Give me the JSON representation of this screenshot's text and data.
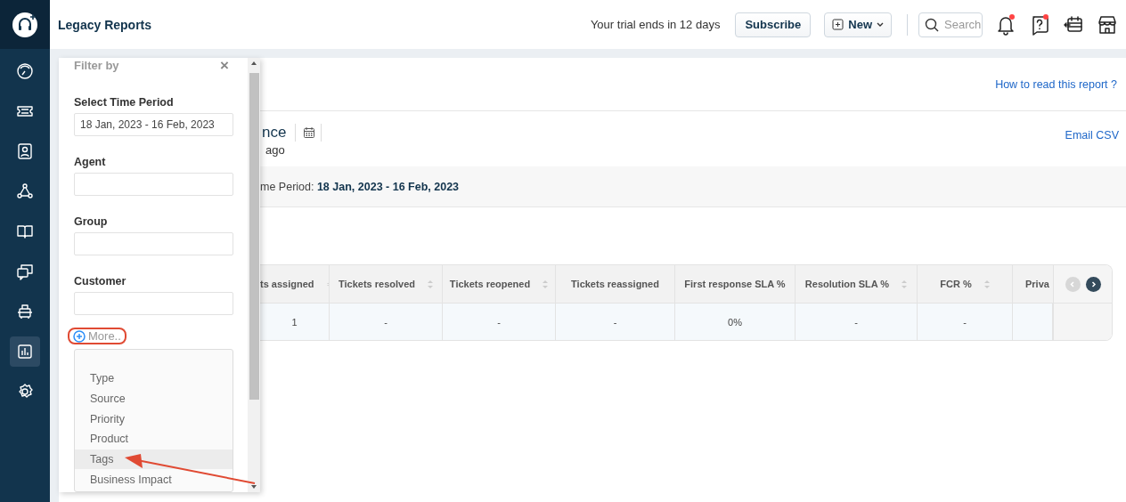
{
  "app": {
    "title": "Legacy Reports"
  },
  "sidebar": {
    "items": [
      {
        "kind": "dashboard",
        "selected": false
      },
      {
        "kind": "tickets",
        "selected": false
      },
      {
        "kind": "contacts",
        "selected": false
      },
      {
        "kind": "network",
        "selected": false
      },
      {
        "kind": "book",
        "selected": false
      },
      {
        "kind": "chat",
        "selected": false
      },
      {
        "kind": "bot",
        "selected": false
      },
      {
        "kind": "reports",
        "selected": true
      },
      {
        "kind": "settings",
        "selected": false
      }
    ]
  },
  "header": {
    "trial_text": "Your trial ends in 12 days",
    "subscribe": "Subscribe",
    "new_button": "New",
    "search": {
      "placeholder": "Search"
    },
    "icons": [
      {
        "kind": "bell",
        "badge": true
      },
      {
        "kind": "help",
        "badge": true
      },
      {
        "kind": "calendar",
        "badge": false
      },
      {
        "kind": "store",
        "badge": false
      }
    ]
  },
  "report": {
    "help_link": "How to read this report ?",
    "title": "nce",
    "subtitle": "ago",
    "email_link": "Email CSV",
    "period_label": "me Period:",
    "period_value": "18 Jan, 2023 - 16 Feb, 2023"
  },
  "table": {
    "columns": [
      {
        "label": "ts assigned",
        "sortable": true
      },
      {
        "label": "Tickets resolved",
        "sortable": true
      },
      {
        "label": "Tickets reopened",
        "sortable": true
      },
      {
        "label": "Tickets reassigned",
        "sortable": false
      },
      {
        "label": "First response SLA %",
        "sortable": false
      },
      {
        "label": "Resolution SLA %",
        "sortable": true
      },
      {
        "label": "FCR %",
        "sortable": true
      }
    ],
    "cut_column": {
      "label": "Priva"
    },
    "rows": [
      [
        "1",
        "-",
        "-",
        "-",
        "0%",
        "-",
        "-"
      ]
    ],
    "pager": {
      "prev_disabled": true,
      "next_disabled": false
    }
  },
  "filter": {
    "title": "Filter by",
    "close": "×",
    "fields": [
      {
        "label": "Select Time Period",
        "value": "18 Jan, 2023 - 16 Feb, 2023"
      },
      {
        "label": "Agent"
      },
      {
        "label": "Group"
      },
      {
        "label": "Customer"
      }
    ],
    "more": "More..",
    "more_options": [
      {
        "label": "Type",
        "selected": false
      },
      {
        "label": "Source",
        "selected": false
      },
      {
        "label": "Priority",
        "selected": false
      },
      {
        "label": "Product",
        "selected": false
      },
      {
        "label": "Tags",
        "selected": true
      },
      {
        "label": "Business Impact",
        "selected": false
      }
    ]
  }
}
